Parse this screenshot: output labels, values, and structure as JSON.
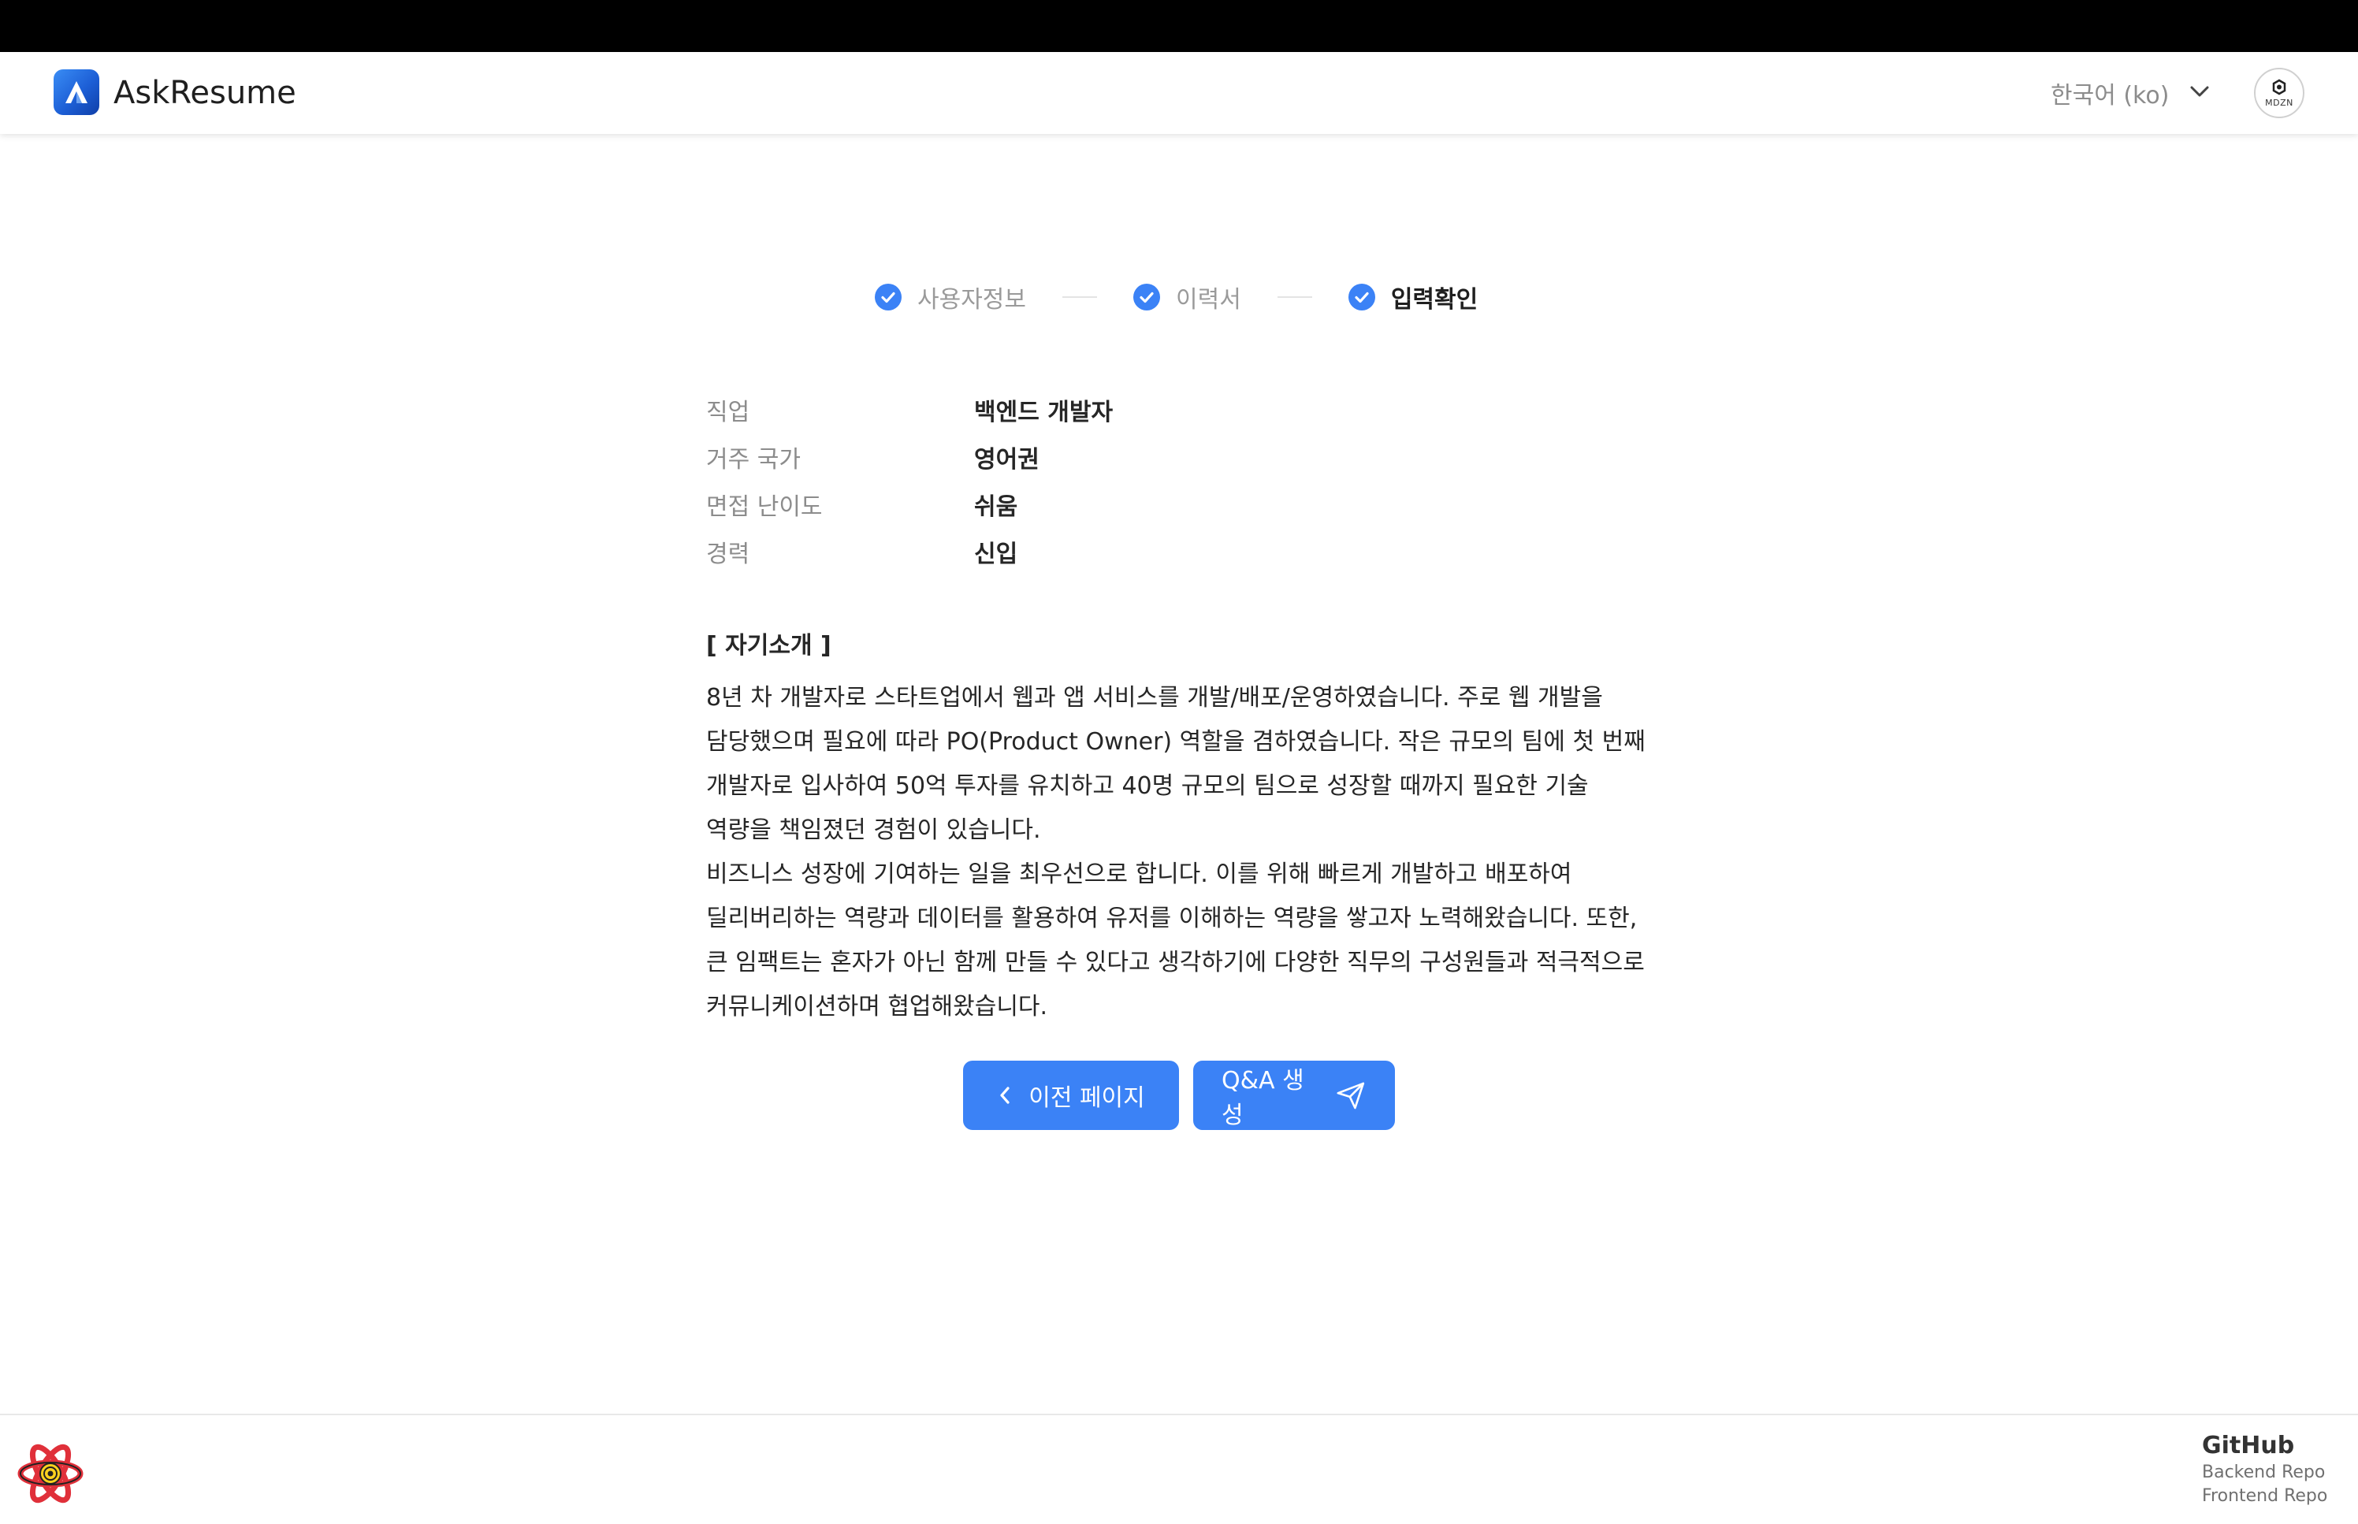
{
  "header": {
    "app_title": "AskResume",
    "language": "한국어 (ko)",
    "avatar_text": "MDZN"
  },
  "steps": [
    {
      "label": "사용자정보",
      "done": true
    },
    {
      "label": "이력서",
      "done": true
    },
    {
      "label": "입력확인",
      "done": true,
      "active": true
    }
  ],
  "info": [
    {
      "key": "직업",
      "value": "백엔드 개발자"
    },
    {
      "key": "거주 국가",
      "value": "영어권"
    },
    {
      "key": "면접 난이도",
      "value": "쉬움"
    },
    {
      "key": "경력",
      "value": "신입"
    }
  ],
  "intro": {
    "title": "[ 자기소개 ]",
    "body": "8년 차 개발자로 스타트업에서 웹과 앱 서비스를 개발/배포/운영하였습니다. 주로 웹 개발을 담당했으며 필요에 따라 PO(Product Owner) 역할을 겸하였습니다. 작은 규모의 팀에 첫 번째 개발자로 입사하여 50억 투자를 유치하고 40명 규모의 팀으로 성장할 때까지 필요한 기술 역량을 책임졌던 경험이 있습니다.\n비즈니스 성장에 기여하는 일을 최우선으로 합니다. 이를 위해 빠르게 개발하고 배포하여 딜리버리하는 역량과 데이터를 활용하여 유저를 이해하는 역량을 쌓고자 노력해왔습니다. 또한, 큰 임팩트는 혼자가 아닌 함께 만들 수 있다고 생각하기에 다양한 직무의 구성원들과 적극적으로 커뮤니케이션하며 협업해왔습니다."
  },
  "buttons": {
    "prev": "이전 페이지",
    "generate": "Q&A 생성"
  },
  "footer": {
    "github": "GitHub",
    "backend": "Backend Repo",
    "frontend": "Frontend Repo"
  },
  "colors": {
    "accent": "#3b82f6",
    "topbar": "#000000"
  }
}
